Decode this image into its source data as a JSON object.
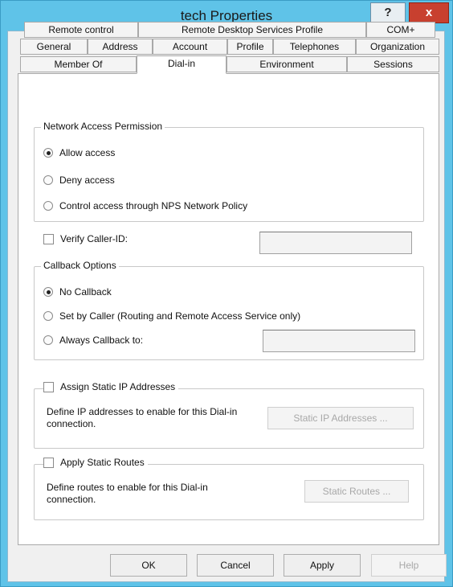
{
  "window": {
    "title": "tech Properties",
    "help_glyph": "?",
    "close_glyph": "x"
  },
  "tabs": {
    "row1": [
      "Remote control",
      "Remote Desktop Services Profile",
      "COM+"
    ],
    "row2": [
      "General",
      "Address",
      "Account",
      "Profile",
      "Telephones",
      "Organization"
    ],
    "row3": [
      "Member Of",
      "Dial-in",
      "Environment",
      "Sessions"
    ],
    "active": "Dial-in"
  },
  "network_access": {
    "legend": "Network Access Permission",
    "options": [
      "Allow access",
      "Deny access",
      "Control access through NPS Network Policy"
    ],
    "selected": 0
  },
  "verify_caller": {
    "label": "Verify Caller-ID:",
    "checked": false,
    "value": ""
  },
  "callback": {
    "legend": "Callback Options",
    "options": [
      "No Callback",
      "Set by Caller (Routing and Remote Access Service only)",
      "Always Callback to:"
    ],
    "selected": 0,
    "always_value": ""
  },
  "static_ip": {
    "checkbox_label": "Assign Static IP Addresses",
    "checked": false,
    "description": "Define IP addresses to enable for this Dial-in connection.",
    "button_label": "Static IP Addresses ..."
  },
  "static_routes": {
    "checkbox_label": "Apply Static Routes",
    "checked": false,
    "description": "Define routes to enable for this Dial-in connection.",
    "button_label": "Static Routes ..."
  },
  "footer": {
    "ok_label": "OK",
    "cancel_label": "Cancel",
    "apply_label": "Apply",
    "help_label": "Help"
  }
}
